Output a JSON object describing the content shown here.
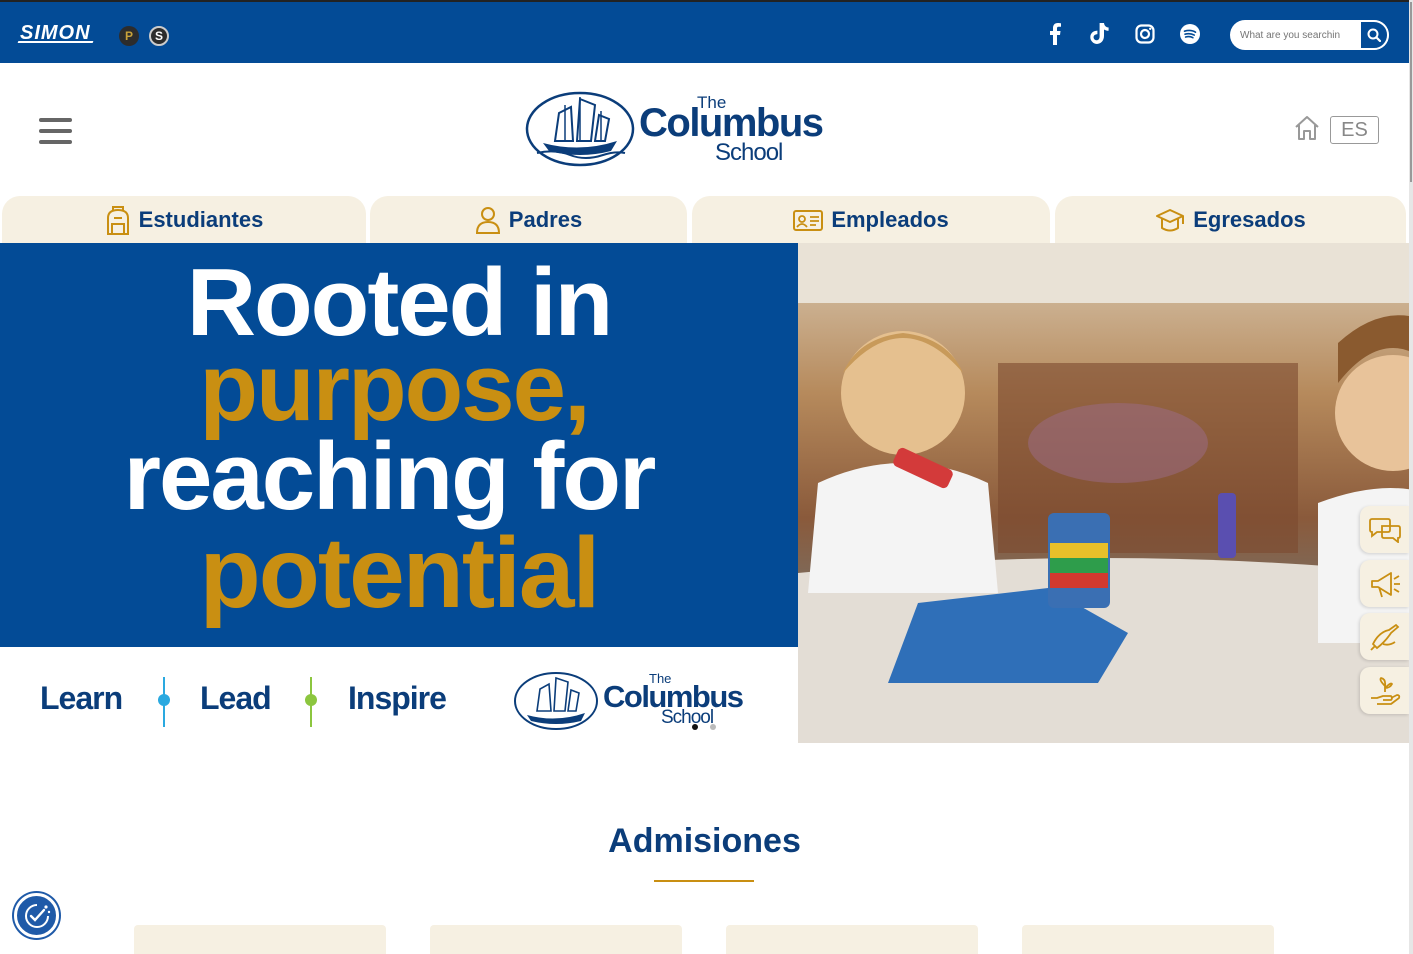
{
  "topbar": {
    "brand": "SIMON",
    "badge_p": "P",
    "badge_s": "S",
    "social": [
      "facebook-icon",
      "tiktok-icon",
      "instagram-icon",
      "spotify-icon"
    ],
    "search_placeholder": "What are you searchin",
    "colors": {
      "bar": "#034b96"
    }
  },
  "header": {
    "logo_the": "The",
    "logo_columbus": "Columbus",
    "logo_school": "School",
    "lang": "ES"
  },
  "tabs": [
    {
      "label": "Estudiantes",
      "icon": "backpack-icon"
    },
    {
      "label": "Padres",
      "icon": "user-icon"
    },
    {
      "label": "Empleados",
      "icon": "id-card-icon"
    },
    {
      "label": "Egresados",
      "icon": "graduation-cap-icon"
    }
  ],
  "hero": {
    "line1": "Rooted in",
    "line2": "purpose,",
    "line3": "reaching for",
    "line4": "potential",
    "tag_learn": "Learn",
    "tag_lead": "Lead",
    "tag_inspire": "Inspire",
    "colors": {
      "blue": "#034b96",
      "gold": "#c98f12"
    }
  },
  "side_buttons": [
    "chat-icon",
    "megaphone-icon",
    "hand-pen-icon",
    "hand-plant-icon"
  ],
  "admisiones": {
    "title": "Admisiones"
  }
}
